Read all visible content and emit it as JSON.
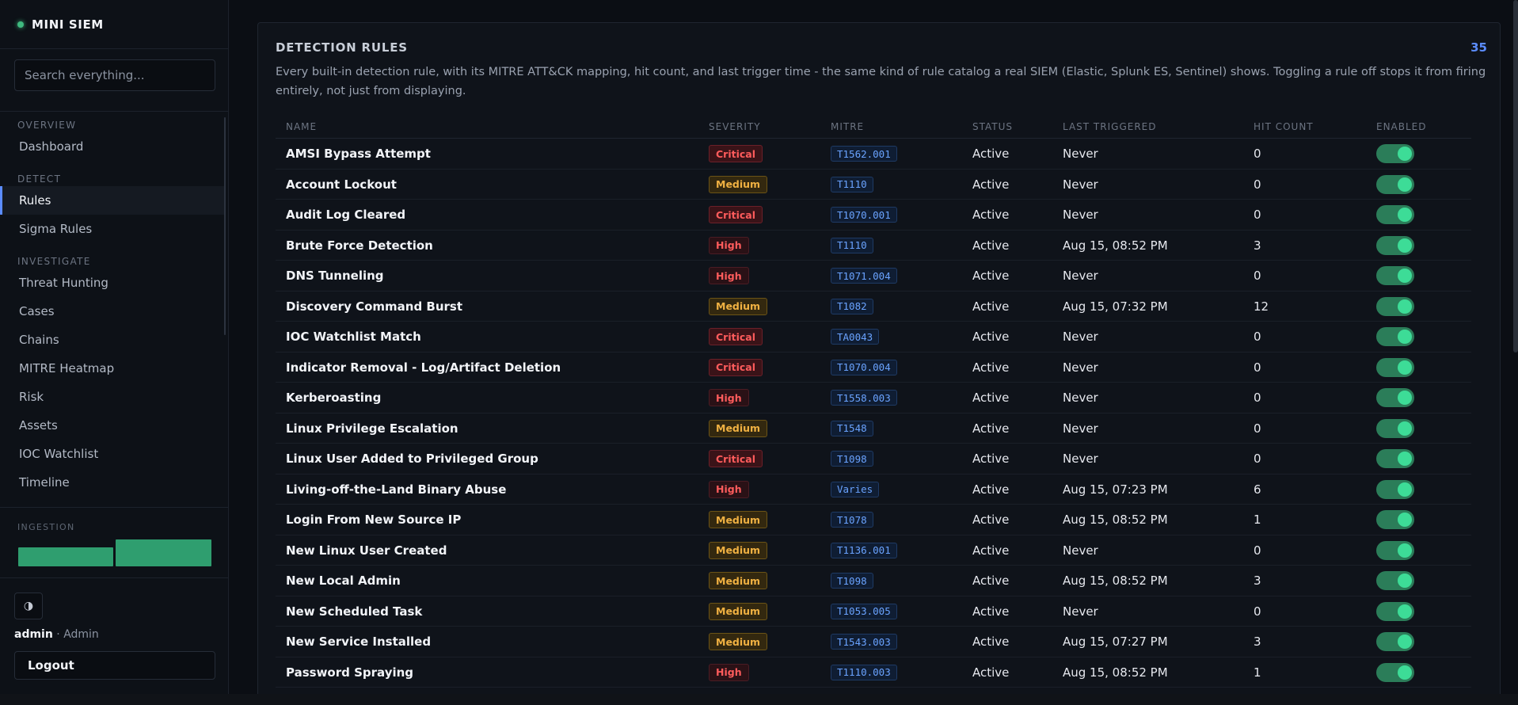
{
  "app": {
    "name": "MINI SIEM"
  },
  "search": {
    "placeholder": "Search everything..."
  },
  "nav": {
    "sections": [
      {
        "label": "OVERVIEW",
        "items": [
          "Dashboard"
        ]
      },
      {
        "label": "DETECT",
        "items": [
          "Rules",
          "Sigma Rules"
        ]
      },
      {
        "label": "INVESTIGATE",
        "items": [
          "Threat Hunting",
          "Cases",
          "Chains",
          "MITRE Heatmap",
          "Risk",
          "Assets",
          "IOC Watchlist",
          "Timeline"
        ]
      }
    ],
    "active": "Rules"
  },
  "ingestion": {
    "label": "INGESTION"
  },
  "theme_toggle": {
    "icon": "contrast-icon",
    "glyph": "◑"
  },
  "user": {
    "name": "admin",
    "role": "Admin",
    "separator": " · "
  },
  "logout": {
    "label": "Logout"
  },
  "panel": {
    "title": "DETECTION RULES",
    "count": "35",
    "description": "Every built-in detection rule, with its MITRE ATT&CK mapping, hit count, and last trigger time - the same kind of rule catalog a real SIEM (Elastic, Splunk ES, Sentinel) shows. Toggling a rule off stops it from firing entirely, not just from displaying."
  },
  "table": {
    "columns": [
      "NAME",
      "SEVERITY",
      "MITRE",
      "STATUS",
      "LAST TRIGGERED",
      "HIT COUNT",
      "ENABLED"
    ],
    "rows": [
      {
        "name": "AMSI Bypass Attempt",
        "severity": "Critical",
        "mitre": "T1562.001",
        "status": "Active",
        "last": "Never",
        "hits": "0",
        "enabled": true
      },
      {
        "name": "Account Lockout",
        "severity": "Medium",
        "mitre": "T1110",
        "status": "Active",
        "last": "Never",
        "hits": "0",
        "enabled": true
      },
      {
        "name": "Audit Log Cleared",
        "severity": "Critical",
        "mitre": "T1070.001",
        "status": "Active",
        "last": "Never",
        "hits": "0",
        "enabled": true
      },
      {
        "name": "Brute Force Detection",
        "severity": "High",
        "mitre": "T1110",
        "status": "Active",
        "last": "Aug 15, 08:52 PM",
        "hits": "3",
        "enabled": true
      },
      {
        "name": "DNS Tunneling",
        "severity": "High",
        "mitre": "T1071.004",
        "status": "Active",
        "last": "Never",
        "hits": "0",
        "enabled": true
      },
      {
        "name": "Discovery Command Burst",
        "severity": "Medium",
        "mitre": "T1082",
        "status": "Active",
        "last": "Aug 15, 07:32 PM",
        "hits": "12",
        "enabled": true
      },
      {
        "name": "IOC Watchlist Match",
        "severity": "Critical",
        "mitre": "TA0043",
        "status": "Active",
        "last": "Never",
        "hits": "0",
        "enabled": true
      },
      {
        "name": "Indicator Removal - Log/Artifact Deletion",
        "severity": "Critical",
        "mitre": "T1070.004",
        "status": "Active",
        "last": "Never",
        "hits": "0",
        "enabled": true
      },
      {
        "name": "Kerberoasting",
        "severity": "High",
        "mitre": "T1558.003",
        "status": "Active",
        "last": "Never",
        "hits": "0",
        "enabled": true
      },
      {
        "name": "Linux Privilege Escalation",
        "severity": "Medium",
        "mitre": "T1548",
        "status": "Active",
        "last": "Never",
        "hits": "0",
        "enabled": true
      },
      {
        "name": "Linux User Added to Privileged Group",
        "severity": "Critical",
        "mitre": "T1098",
        "status": "Active",
        "last": "Never",
        "hits": "0",
        "enabled": true
      },
      {
        "name": "Living-off-the-Land Binary Abuse",
        "severity": "High",
        "mitre": "Varies",
        "status": "Active",
        "last": "Aug 15, 07:23 PM",
        "hits": "6",
        "enabled": true
      },
      {
        "name": "Login From New Source IP",
        "severity": "Medium",
        "mitre": "T1078",
        "status": "Active",
        "last": "Aug 15, 08:52 PM",
        "hits": "1",
        "enabled": true
      },
      {
        "name": "New Linux User Created",
        "severity": "Medium",
        "mitre": "T1136.001",
        "status": "Active",
        "last": "Never",
        "hits": "0",
        "enabled": true
      },
      {
        "name": "New Local Admin",
        "severity": "Medium",
        "mitre": "T1098",
        "status": "Active",
        "last": "Aug 15, 08:52 PM",
        "hits": "3",
        "enabled": true
      },
      {
        "name": "New Scheduled Task",
        "severity": "Medium",
        "mitre": "T1053.005",
        "status": "Active",
        "last": "Never",
        "hits": "0",
        "enabled": true
      },
      {
        "name": "New Service Installed",
        "severity": "Medium",
        "mitre": "T1543.003",
        "status": "Active",
        "last": "Aug 15, 07:27 PM",
        "hits": "3",
        "enabled": true
      },
      {
        "name": "Password Spraying",
        "severity": "High",
        "mitre": "T1110.003",
        "status": "Active",
        "last": "Aug 15, 08:52 PM",
        "hits": "1",
        "enabled": true
      }
    ]
  }
}
